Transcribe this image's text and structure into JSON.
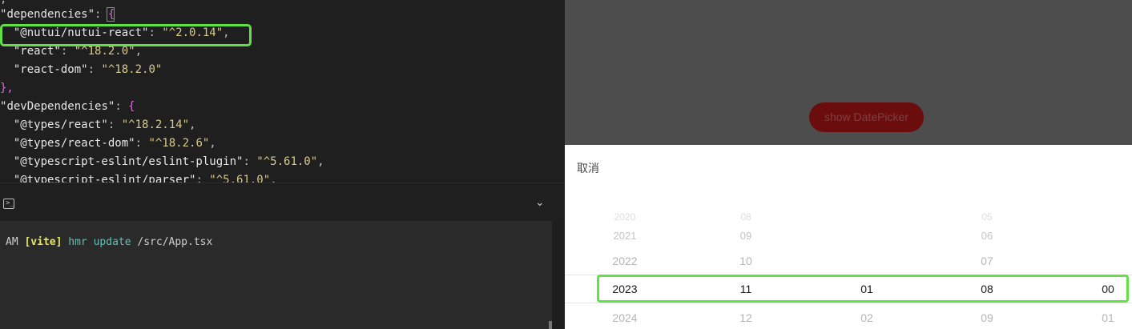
{
  "editor": {
    "lines": [
      {
        "key": "dependencies",
        "prefix": "\"",
        "open": "{"
      },
      {
        "name": "\"@nutui/nutui-react\"",
        "value": "\"^2.0.14\"",
        "comma": ","
      },
      {
        "name": "\"react\"",
        "value": "\"^18.2.0\"",
        "comma": ","
      },
      {
        "name": "\"react-dom\"",
        "value": "\"^18.2.0\"",
        "comma": ""
      },
      {
        "close": "},"
      },
      {
        "key": "devDependencies",
        "prefix": "\"",
        "open": "{"
      },
      {
        "name": "\"@types/react\"",
        "value": "\"^18.2.14\"",
        "comma": ","
      },
      {
        "name": "\"@types/react-dom\"",
        "value": "\"^18.2.6\"",
        "comma": ","
      },
      {
        "name": "\"@typescript-eslint/eslint-plugin\"",
        "value": "\"^5.61.0\"",
        "comma": ","
      },
      {
        "name": "\"@typescript-eslint/parser\"",
        "value": "\"^5.61.0\"",
        "comma": ","
      }
    ]
  },
  "terminal": {
    "time_suffix": "AM",
    "tag": "[vite]",
    "message": "hmr update",
    "path": "/src/App.tsx"
  },
  "preview": {
    "show_button_label": "show DatePicker",
    "cancel_label": "取消",
    "columns": [
      {
        "items": [
          "2020",
          "2021",
          "2022",
          "2023",
          "2024"
        ],
        "selected": "2023"
      },
      {
        "items": [
          "08",
          "09",
          "10",
          "11",
          "12"
        ],
        "selected": "11"
      },
      {
        "items": [
          "",
          "",
          "",
          "01",
          "02"
        ],
        "selected": "01"
      },
      {
        "items": [
          "05",
          "06",
          "07",
          "08",
          "09"
        ],
        "selected": "08"
      },
      {
        "items": [
          "",
          "",
          "",
          "00",
          "01"
        ],
        "selected": "00"
      }
    ]
  },
  "colors": {
    "highlight": "#62e145",
    "button_bg": "#6b0d0d",
    "overlay": "#4d4d4d"
  }
}
